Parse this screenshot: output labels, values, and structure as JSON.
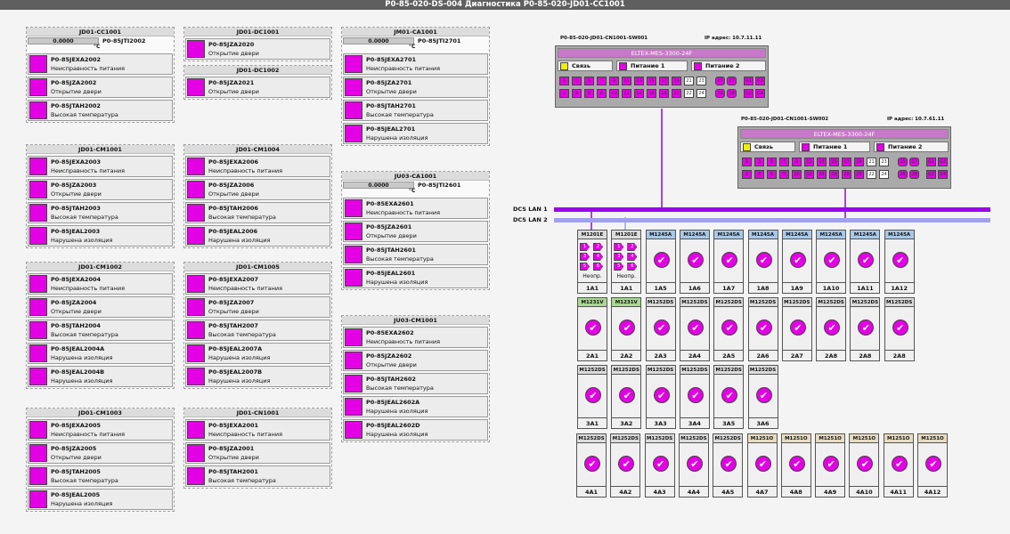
{
  "title": "P0-85-020-DS-004 Диагностика P0-85-020-JD01-CC1001",
  "groups": [
    {
      "title": "JD01-CC1001",
      "meas": {
        "value": "0.0000",
        "unit": "°C",
        "tag": "P0-85JTI2002"
      },
      "rows": [
        {
          "tag": "P0-85JEXA2002",
          "desc": "Неисправность питания"
        },
        {
          "tag": "P0-85JZA2002",
          "desc": "Открытие двери"
        },
        {
          "tag": "P0-85JTAH2002",
          "desc": "Высокая температура"
        }
      ]
    },
    {
      "title": "JD01-CM1001",
      "rows": [
        {
          "tag": "P0-85JEXA2003",
          "desc": "Неисправность питания"
        },
        {
          "tag": "P0-85JZA2003",
          "desc": "Открытие двери"
        },
        {
          "tag": "P0-85JTAH2003",
          "desc": "Высокая температура"
        },
        {
          "tag": "P0-85JEAL2003",
          "desc": "Нарушена изоляция"
        }
      ]
    },
    {
      "title": "JD01-CM1002",
      "rows": [
        {
          "tag": "P0-85JEXA2004",
          "desc": "Неисправность питания"
        },
        {
          "tag": "P0-85JZA2004",
          "desc": "Открытие двери"
        },
        {
          "tag": "P0-85JTAH2004",
          "desc": "Высокая температура"
        },
        {
          "tag": "P0-85JEAL2004A",
          "desc": "Нарушена изоляция"
        },
        {
          "tag": "P0-85JEAL2004B",
          "desc": "Нарушена изоляция"
        }
      ]
    },
    {
      "title": "JD01-CM1003",
      "rows": [
        {
          "tag": "P0-85JEXA2005",
          "desc": "Неисправность питания"
        },
        {
          "tag": "P0-85JZA2005",
          "desc": "Открытие двери"
        },
        {
          "tag": "P0-85JTAH2005",
          "desc": "Высокая температура"
        },
        {
          "tag": "P0-85JEAL2005",
          "desc": "Нарушена изоляция"
        }
      ]
    },
    {
      "title": "JD01-DC1001",
      "rows": [
        {
          "tag": "P0-85JZA2020",
          "desc": "Открытие двери"
        }
      ]
    },
    {
      "title": "JD01-DC1002",
      "rows": [
        {
          "tag": "P0-85JZA2021",
          "desc": "Открытие двери"
        }
      ]
    },
    {
      "title": "JD01-CM1004",
      "rows": [
        {
          "tag": "P0-85JEXA2006",
          "desc": "Неисправность питания"
        },
        {
          "tag": "P0-85JZA2006",
          "desc": "Открытие двери"
        },
        {
          "tag": "P0-85JTAH2006",
          "desc": "Высокая температура"
        },
        {
          "tag": "P0-85JEAL2006",
          "desc": "Нарушена изоляция"
        }
      ]
    },
    {
      "title": "JD01-CM1005",
      "rows": [
        {
          "tag": "P0-85JEXA2007",
          "desc": "Неисправность питания"
        },
        {
          "tag": "P0-85JZA2007",
          "desc": "Открытие двери"
        },
        {
          "tag": "P0-85JTAH2007",
          "desc": "Высокая температура"
        },
        {
          "tag": "P0-85JEAL2007A",
          "desc": "Нарушена изоляция"
        },
        {
          "tag": "P0-85JEAL2007B",
          "desc": "Нарушена изоляция"
        }
      ]
    },
    {
      "title": "JD01-CN1001",
      "rows": [
        {
          "tag": "P0-85JEXA2001",
          "desc": "Неисправность питания"
        },
        {
          "tag": "P0-85JZA2001",
          "desc": "Открытие двери"
        },
        {
          "tag": "P0-85JTAH2001",
          "desc": "Высокая температура"
        }
      ]
    },
    {
      "title": "JM01-CA1001",
      "meas": {
        "value": "0.0000",
        "unit": "°C",
        "tag": "P0-85JTI2701"
      },
      "rows": [
        {
          "tag": "P0-85JEXA2701",
          "desc": "Неисправность питания"
        },
        {
          "tag": "P0-85JZA2701",
          "desc": "Открытие двери"
        },
        {
          "tag": "P0-85JTAH2701",
          "desc": "Высокая температура"
        },
        {
          "tag": "P0-85JEAL2701",
          "desc": "Нарушена изоляция"
        }
      ]
    },
    {
      "title": "JU03-CA1001",
      "meas": {
        "value": "0.0000",
        "unit": "°C",
        "tag": "P0-85JTI2601"
      },
      "rows": [
        {
          "tag": "P0-85EXA2601",
          "desc": "Неисправность питания"
        },
        {
          "tag": "P0-85JZA2601",
          "desc": "Открытие двери"
        },
        {
          "tag": "P0-85JTAH2601",
          "desc": "Высокая температура"
        },
        {
          "tag": "P0-85JEAL2601",
          "desc": "Нарушена изоляция"
        }
      ]
    },
    {
      "title": "JU03-CM1001",
      "rows": [
        {
          "tag": "P0-85EXA2602",
          "desc": "Неисправность питания"
        },
        {
          "tag": "P0-85JZA2602",
          "desc": "Открытие двери"
        },
        {
          "tag": "P0-85JTAH2602",
          "desc": "Высокая температура"
        },
        {
          "tag": "P0-85JEAL2602A",
          "desc": "Нарушена изоляция"
        },
        {
          "tag": "P0-85JEAL2602D",
          "desc": "Нарушена изоляция"
        }
      ]
    }
  ],
  "switches": [
    {
      "name": "P0-85-020-JD01-CN1001-SW001",
      "ip": "IP адрес: 10.7.11.11",
      "model": "ELTEX-MES-3300-24F",
      "legend": [
        "Связь",
        "Питание 1",
        "Питание 2"
      ],
      "top": [
        "1",
        "3",
        "5",
        "7",
        "9",
        "11",
        "13",
        "15",
        "17",
        "19",
        "21",
        "23"
      ],
      "bottom": [
        "2",
        "4",
        "6",
        "8",
        "10",
        "12",
        "14",
        "16",
        "18",
        "20",
        "22",
        "24"
      ],
      "sfp": [
        "25",
        "27",
        "26",
        "28"
      ],
      "g": [
        "G1",
        "G3",
        "G2",
        "G4"
      ]
    },
    {
      "name": "P0-85-020-JD01-CN1001-SW002",
      "ip": "IP адрес: 10.7.61.11",
      "model": "ELTEX-MES-3300-24F",
      "legend": [
        "Связь",
        "Питание 1",
        "Питание 2"
      ],
      "top": [
        "1",
        "3",
        "5",
        "7",
        "9",
        "11",
        "13",
        "15",
        "17",
        "19",
        "21",
        "23"
      ],
      "bottom": [
        "2",
        "4",
        "6",
        "8",
        "10",
        "12",
        "14",
        "16",
        "18",
        "20",
        "22",
        "24"
      ],
      "sfp": [
        "25",
        "27",
        "26",
        "28"
      ],
      "g": [
        "G1",
        "G3",
        "G2",
        "G4"
      ]
    }
  ],
  "lans": [
    "DCS LAN 1",
    "DCS LAN 2"
  ],
  "racks": [
    [
      {
        "m": "M1201E",
        "l": "1A1",
        "n": "Неопр."
      },
      {
        "m": "M1201E",
        "l": "1A1",
        "n": "Неопр."
      },
      {
        "m": "M1245A",
        "l": "1A5"
      },
      {
        "m": "M1245A",
        "l": "1A6"
      },
      {
        "m": "M1245A",
        "l": "1A7"
      },
      {
        "m": "M1245A",
        "l": "1A8"
      },
      {
        "m": "M1245A",
        "l": "1A9"
      },
      {
        "m": "M1245A",
        "l": "1A10"
      },
      {
        "m": "M1245A",
        "l": "1A11"
      },
      {
        "m": "M1245A",
        "l": "1A12"
      }
    ],
    [
      {
        "m": "M1231V",
        "l": "2A1"
      },
      {
        "m": "M1231V",
        "l": "2A2"
      },
      {
        "m": "M1252DS",
        "l": "2A3"
      },
      {
        "m": "M1252DS",
        "l": "2A4"
      },
      {
        "m": "M1252DS",
        "l": "2A5"
      },
      {
        "m": "M1252DS",
        "l": "2A6"
      },
      {
        "m": "M1252DS",
        "l": "2A7"
      },
      {
        "m": "M1252DS",
        "l": "2A8"
      },
      {
        "m": "M1252DS",
        "l": "2A8"
      },
      {
        "m": "M1252DS",
        "l": "2A8"
      }
    ],
    [
      {
        "m": "M1252DS",
        "l": "3A1"
      },
      {
        "m": "M1252DS",
        "l": "3A2"
      },
      {
        "m": "M1252DS",
        "l": "3A3"
      },
      {
        "m": "M1252DS",
        "l": "3A4"
      },
      {
        "m": "M1252DS",
        "l": "3A5"
      },
      {
        "m": "M1252DS",
        "l": "3A6"
      }
    ],
    [
      {
        "m": "M1252DS",
        "l": "4A1"
      },
      {
        "m": "M1252DS",
        "l": "4A2"
      },
      {
        "m": "M1252DS",
        "l": "4A3"
      },
      {
        "m": "M1252DS",
        "l": "4A4"
      },
      {
        "m": "M1252DS",
        "l": "4A5"
      },
      {
        "m": "M1251O",
        "l": "4A7"
      },
      {
        "m": "M1251O",
        "l": "4A8"
      },
      {
        "m": "M1251O",
        "l": "4A9"
      },
      {
        "m": "M1251O",
        "l": "4A10"
      },
      {
        "m": "M1251O",
        "l": "4A11"
      },
      {
        "m": "M1251O",
        "l": "4A12"
      }
    ]
  ],
  "colors": {
    "alarm": "#e400e4",
    "lan1": "#9a00e8",
    "lan2": "#a0a0f0",
    "M1201E": "#dcdcdc",
    "M1245A": "#a8c8e8",
    "M1231V": "#a8d890",
    "M1252DS": "#dcdcdc",
    "M1251O": "#e8dcc0"
  }
}
